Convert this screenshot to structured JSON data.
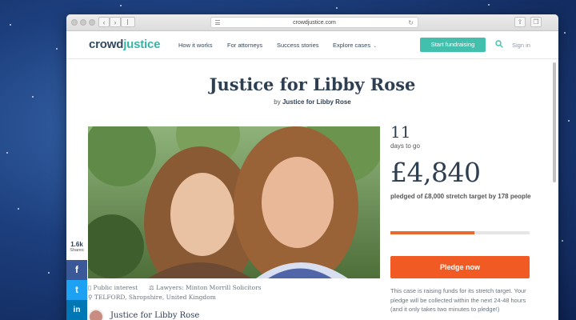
{
  "browser": {
    "url": "crowdjustice.com"
  },
  "site_nav": {
    "logo_crowd": "crowd",
    "logo_justice": "justice",
    "links": [
      "How it works",
      "For attorneys",
      "Success stories",
      "Explore cases"
    ],
    "start_button": "Start fundraising",
    "signin": "Sign in"
  },
  "case": {
    "title": "Justice for Libby Rose",
    "by_prefix": "by",
    "by_name": "Justice for Libby Rose",
    "category": "Public interest",
    "lawyers": "Lawyers: Minton Morrill Solicitors",
    "location": "TELFORD, Shropshire, United Kingdom",
    "owner_name": "Justice for Libby Rose"
  },
  "social": {
    "shares_count": "1.6k",
    "shares_label": "Shares",
    "facebook": "f",
    "twitter": "t",
    "linkedin": "in"
  },
  "stats": {
    "days_left": "11",
    "days_label": "days to go",
    "amount": "£4,840",
    "pledged_text": "pledged of £8,000 stretch target by 178 people",
    "progress_fraction": 0.605,
    "pledge_button": "Pledge now",
    "stretch_text": "This case is raising funds for its stretch target. Your pledge will be collected within the next 24-48 hours (and it only takes two minutes to pledge!)"
  },
  "colors": {
    "accent_teal": "#43c0ad",
    "pledge_orange": "#f25a23",
    "facebook": "#3b5998",
    "twitter": "#1da1f2",
    "linkedin": "#0077b5"
  },
  "icons": [
    "search-icon",
    "bookmark-icon",
    "scales-icon",
    "map-pin-icon"
  ]
}
